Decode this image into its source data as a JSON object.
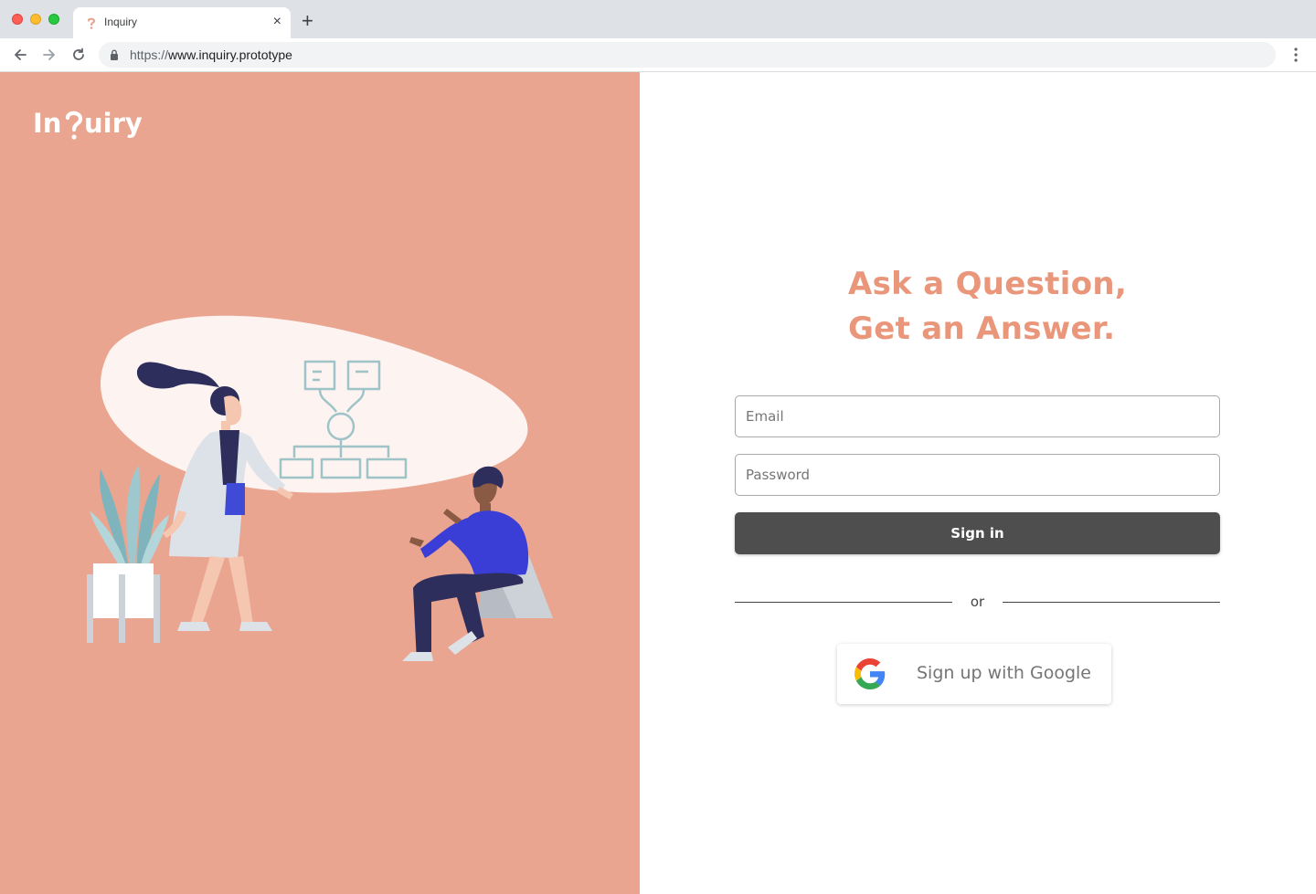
{
  "browser": {
    "tab_title": "Inquiry",
    "tab_close": "×",
    "new_tab": "+",
    "url_scheme": "https://",
    "url_host": "www.inquiry.prototype"
  },
  "brand": {
    "logo_text": "InQuiry",
    "color": "#e9a58f",
    "headline_color": "#e9967a"
  },
  "hero": {
    "headline_line1": "Ask a Question,",
    "headline_line2": "Get an Answer."
  },
  "form": {
    "email_placeholder": "Email",
    "password_placeholder": "Password",
    "signin_label": "Sign in",
    "divider_text": "or",
    "google_label": "Sign up with Google"
  },
  "icons": [
    "back-arrow-icon",
    "forward-arrow-icon",
    "reload-icon",
    "lock-icon",
    "menu-dots-icon",
    "google-icon",
    "question-mark-favicon"
  ]
}
